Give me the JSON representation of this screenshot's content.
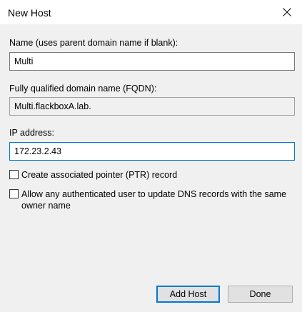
{
  "window": {
    "title": "New Host",
    "close_icon": "close-icon"
  },
  "name_field": {
    "label": "Name (uses parent domain name if blank):",
    "value": "Multi"
  },
  "fqdn_field": {
    "label": "Fully qualified domain name (FQDN):",
    "value": "Multi.flackboxA.lab."
  },
  "ip_field": {
    "label": "IP address:",
    "value": "172.23.2.43"
  },
  "options": {
    "ptr_label": "Create associated pointer (PTR) record",
    "ptr_checked": false,
    "auth_label": "Allow any authenticated user to update DNS records with the same owner name",
    "auth_checked": false
  },
  "buttons": {
    "add_host": "Add Host",
    "done": "Done"
  },
  "colors": {
    "dialog_bg": "#f0f0f0",
    "focus_border": "#0078d7"
  }
}
